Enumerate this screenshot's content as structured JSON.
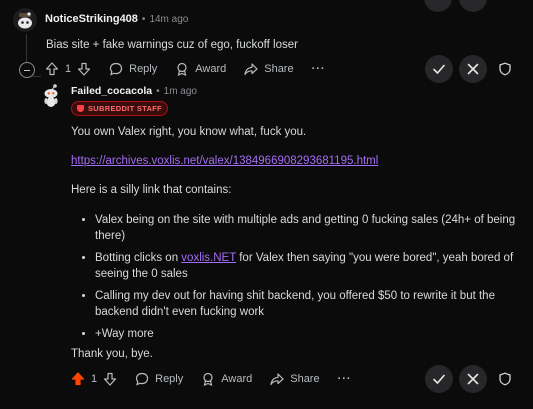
{
  "comment1": {
    "username": "NoticeStriking408",
    "separator": "•",
    "time": "14m ago",
    "body": "Bias site + fake warnings cuz of ego, fuckoff loser",
    "vote_count": "1",
    "reply_label": "Reply",
    "award_label": "Award",
    "share_label": "Share",
    "more_label": "···"
  },
  "comment2": {
    "username": "Failed_cocacola",
    "separator": "•",
    "time": "1m ago",
    "badge": "SUBREDDIT STAFF",
    "para1": "You own Valex right, you know what, fuck you.",
    "url": "https://archives.voxlis.net/valex/1384966908293681195.html",
    "para2": "Here is a silly link that contains:",
    "bullet1": "Valex being on the site with multiple ads and getting 0 fucking sales (24h+ of being there)",
    "bullet2_pre": "Botting clicks on ",
    "bullet2_link": "voxlis.NET",
    "bullet2_post": " for Valex then saying \"you were bored\", yeah bored of seeing the 0 sales",
    "bullet3": "Calling my dev out for having shit backend, you offered $50 to rewrite it but the backend didn't even fucking work",
    "bullet4": "+Way more",
    "closing": "Thank you, bye.",
    "vote_count": "1",
    "reply_label": "Reply",
    "award_label": "Award",
    "share_label": "Share",
    "more_label": "···",
    "upvote_color": "#ff4500"
  },
  "colors": {
    "background": "#0b0b0b",
    "link": "#a56cf5",
    "badge_red": "#b01010"
  }
}
